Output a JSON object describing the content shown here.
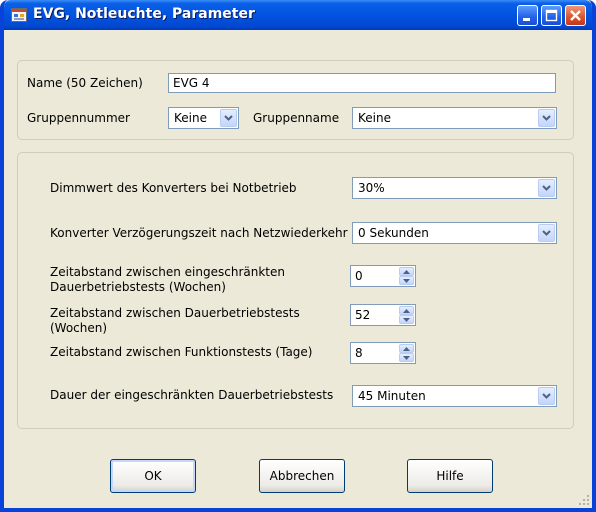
{
  "window": {
    "title": "EVG, Notleuchte, Parameter",
    "icons": {
      "app": "app-window-icon",
      "minimize": "minimize-icon",
      "maximize": "maximize-icon",
      "close": "close-icon"
    }
  },
  "name_group": {
    "name_label": "Name (50 Zeichen)",
    "name_value": "EVG 4",
    "group_number_label": "Gruppennummer",
    "group_number_value": "Keine",
    "group_name_label": "Gruppenname",
    "group_name_value": "Keine"
  },
  "params_group": {
    "dimming_label": "Dimmwert des Konverters bei Notbetrieb",
    "dimming_value": "30%",
    "delay_label": "Konverter Verzögerungszeit nach Netzwiederkehr",
    "delay_value": "0 Sekunden",
    "limited_interval_label": "Zeitabstand zwischen eingeschränkten Dauerbetriebstests (Wochen)",
    "limited_interval_value": "0",
    "full_interval_label": "Zeitabstand zwischen Dauerbetriebstests (Wochen)",
    "full_interval_value": "52",
    "function_interval_label": "Zeitabstand zwischen Funktionstests (Tage)",
    "function_interval_value": "8",
    "limited_duration_label": "Dauer der eingeschränkten Dauerbetriebstests",
    "limited_duration_value": "45 Minuten"
  },
  "buttons": {
    "ok": "OK",
    "cancel": "Abbrechen",
    "help": "Hilfe"
  }
}
